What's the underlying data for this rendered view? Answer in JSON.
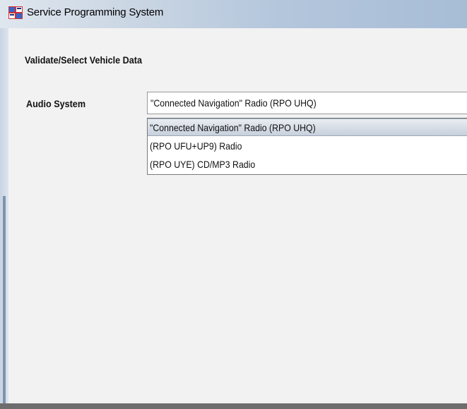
{
  "window": {
    "title": "Service Programming System",
    "icon": "app-icon"
  },
  "main": {
    "heading": "Validate/Select Vehicle Data",
    "field_label": "Audio System",
    "selected_value": "\"Connected Navigation\" Radio (RPO UHQ)",
    "options": [
      "\"Connected Navigation\" Radio (RPO UHQ)",
      "(RPO UFU+UP9) Radio",
      "(RPO UYE) CD/MP3 Radio"
    ]
  }
}
